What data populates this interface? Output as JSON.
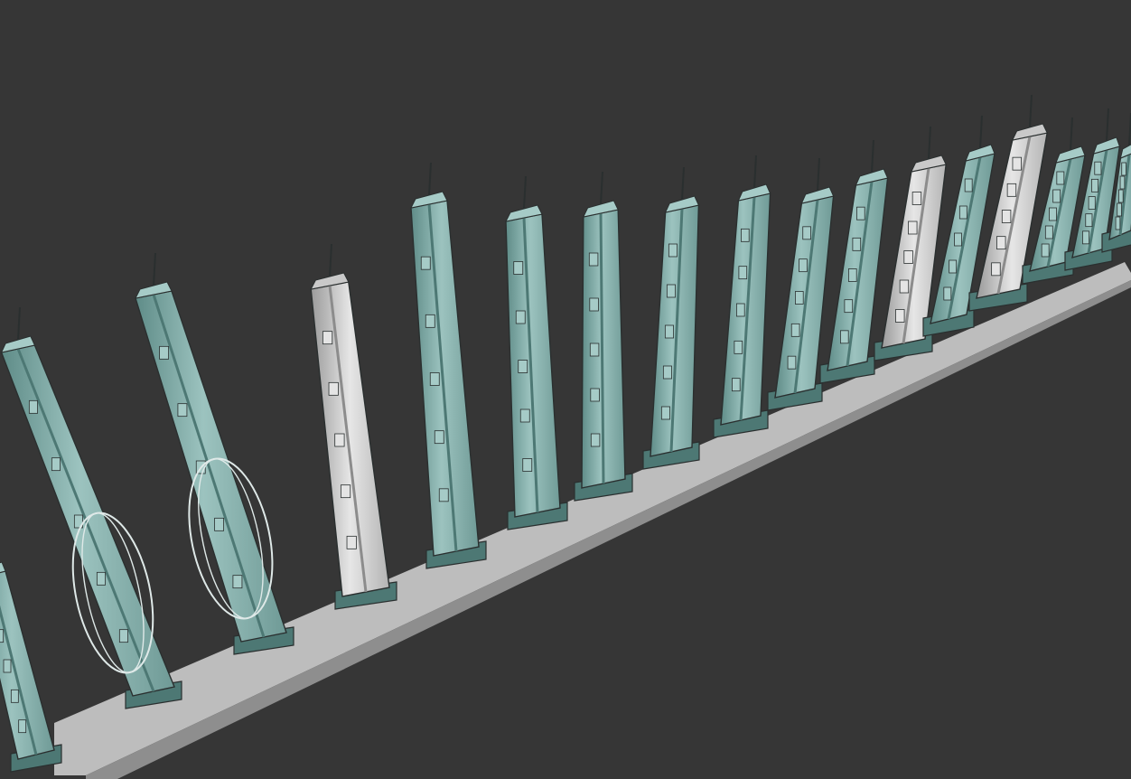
{
  "scene": {
    "kind": "3d-render",
    "subject": "futuristic-skyscraper-models",
    "tower_count": 18,
    "colors": {
      "background": "#363636",
      "platform": "#bdbdbd",
      "platform_edge": "#8e8e8e",
      "glass_teal": "#7ea9a5",
      "glass_teal_light": "#a6cbc7",
      "glass_teal_dark": "#4d7874",
      "concrete": "#c9c9c9",
      "concrete_light": "#e4e4e4",
      "concrete_dark": "#8c8c8c",
      "outline": "#2a2f2f"
    }
  }
}
